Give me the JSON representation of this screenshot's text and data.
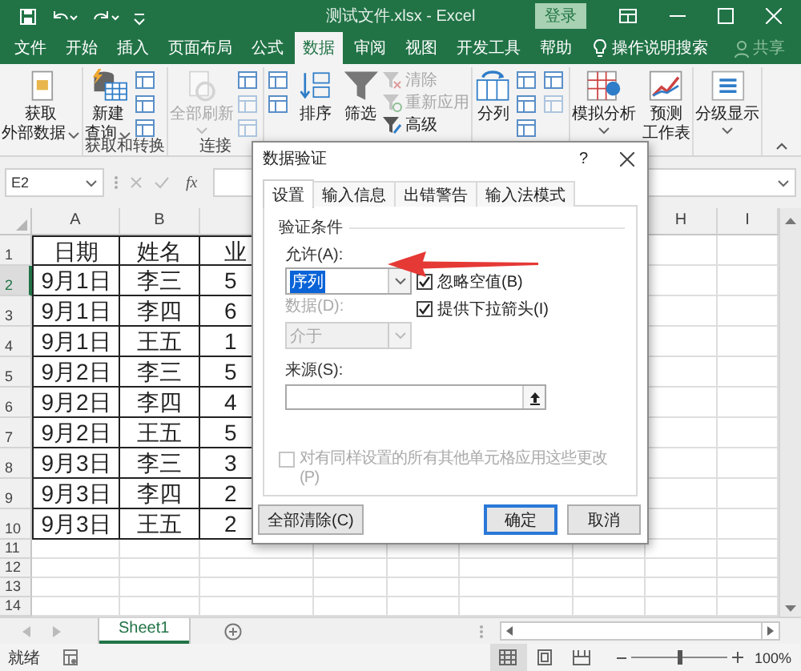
{
  "title_bar": {
    "title": "测试文件.xlsx  -  Excel",
    "sign_in": "登录"
  },
  "ribbon_tabs": [
    {
      "label": "文件",
      "selected": false
    },
    {
      "label": "开始",
      "selected": false
    },
    {
      "label": "插入",
      "selected": false
    },
    {
      "label": "页面布局",
      "selected": false
    },
    {
      "label": "公式",
      "selected": false
    },
    {
      "label": "数据",
      "selected": true
    },
    {
      "label": "审阅",
      "selected": false
    },
    {
      "label": "视图",
      "selected": false
    },
    {
      "label": "开发工具",
      "selected": false
    },
    {
      "label": "帮助",
      "selected": false
    }
  ],
  "tell_me": "操作说明搜索",
  "share": "共享",
  "ribbon_groups": [
    {
      "items": [
        {
          "kind": "large",
          "lines": [
            "获取",
            "外部数据"
          ],
          "dropdown": true,
          "disabled": false
        }
      ]
    },
    {
      "label": "获取和转换",
      "items": [
        {
          "kind": "large",
          "lines": [
            "新建",
            "查询"
          ],
          "dropdown": true,
          "disabled": false
        },
        {
          "kind": "icons",
          "icons": [
            {
              "disabled": false
            },
            {
              "disabled": false
            },
            {
              "disabled": false
            }
          ]
        }
      ]
    },
    {
      "label": "连接",
      "items": [
        {
          "kind": "large",
          "lines": [
            "全部刷新"
          ],
          "dropdown": true,
          "disabled": true
        },
        {
          "kind": "icons",
          "icons": [
            {
              "disabled": false
            },
            {
              "disabled": true
            },
            {
              "disabled": true
            }
          ]
        }
      ]
    },
    {
      "items": [
        {
          "kind": "icons",
          "icons": [
            {
              "disabled": false
            },
            {
              "disabled": false
            }
          ]
        },
        {
          "kind": "large",
          "lines": [
            "排序"
          ],
          "dropdown": false,
          "disabled": false
        },
        {
          "kind": "large",
          "lines": [
            "筛选"
          ],
          "dropdown": false,
          "disabled": false
        },
        {
          "kind": "list",
          "entries": [
            {
              "label": "清除",
              "disabled": true
            },
            {
              "label": "重新应用",
              "disabled": true
            },
            {
              "label": "高级",
              "disabled": false
            }
          ]
        }
      ]
    },
    {
      "items": [
        {
          "kind": "large",
          "lines": [
            "分列"
          ],
          "dropdown": false,
          "disabled": false
        },
        {
          "kind": "icons",
          "icons": [
            {
              "disabled": false
            },
            {
              "disabled": false
            },
            {
              "disabled": false
            }
          ]
        },
        {
          "kind": "icons",
          "icons": [
            {
              "disabled": false
            },
            {
              "disabled": true
            }
          ]
        }
      ]
    },
    {
      "items": [
        {
          "kind": "large",
          "lines": [
            "模拟分析"
          ],
          "dropdown": true,
          "disabled": false
        },
        {
          "kind": "large",
          "lines": [
            "预测",
            "工作表"
          ],
          "dropdown": false,
          "disabled": false
        }
      ]
    },
    {
      "items": [
        {
          "kind": "large",
          "lines": [
            "分级显示"
          ],
          "dropdown": true,
          "disabled": false
        }
      ]
    }
  ],
  "formula_bar": {
    "name_box": "E2",
    "function_button": "fx"
  },
  "sheet": {
    "column_headers_left": [
      "A",
      "B"
    ],
    "column_headers_right": [
      "H",
      "I"
    ],
    "rows": [
      {
        "number": "1",
        "selected": false,
        "cells": [
          "日期",
          "姓名",
          "业"
        ]
      },
      {
        "number": "2",
        "selected": true,
        "cells": [
          "9月1日",
          "李三",
          "5"
        ]
      },
      {
        "number": "3",
        "selected": false,
        "cells": [
          "9月1日",
          "李四",
          "6"
        ]
      },
      {
        "number": "4",
        "selected": false,
        "cells": [
          "9月1日",
          "王五",
          "1"
        ]
      },
      {
        "number": "5",
        "selected": false,
        "cells": [
          "9月2日",
          "李三",
          "5"
        ]
      },
      {
        "number": "6",
        "selected": false,
        "cells": [
          "9月2日",
          "李四",
          "4"
        ]
      },
      {
        "number": "7",
        "selected": false,
        "cells": [
          "9月2日",
          "王五",
          "5"
        ]
      },
      {
        "number": "8",
        "selected": false,
        "cells": [
          "9月3日",
          "李三",
          "3"
        ]
      },
      {
        "number": "9",
        "selected": false,
        "cells": [
          "9月3日",
          "李四",
          "2"
        ]
      },
      {
        "number": "10",
        "selected": false,
        "cells": [
          "9月3日",
          "王五",
          "2"
        ]
      },
      {
        "number": "11",
        "selected": false,
        "cells": []
      },
      {
        "number": "12",
        "selected": false,
        "cells": []
      },
      {
        "number": "13",
        "selected": false,
        "cells": []
      },
      {
        "number": "14",
        "selected": false,
        "cells": []
      }
    ]
  },
  "sheet_tabs": [
    {
      "label": "Sheet1",
      "selected": true
    }
  ],
  "status_bar": {
    "status": "就绪",
    "views": [
      {
        "selected": true
      },
      {
        "selected": false
      },
      {
        "selected": false
      }
    ],
    "zoom": {
      "level": 0.5,
      "reading": "100%"
    }
  },
  "dialog": {
    "title": "数据验证",
    "help": "?",
    "tabs": [
      {
        "label": "设置",
        "selected": true
      },
      {
        "label": "输入信息",
        "selected": false
      },
      {
        "label": "出错警告",
        "selected": false
      },
      {
        "label": "输入法模式",
        "selected": false
      }
    ],
    "section": "验证条件",
    "allow": {
      "label": "允许(A):",
      "value": "序列",
      "focused": true
    },
    "checkboxes": [
      {
        "label": "忽略空值(B)",
        "checked": true
      },
      {
        "label": "提供下拉箭头(I)",
        "checked": true
      }
    ],
    "data": {
      "label": "数据(D):",
      "value": "介于",
      "disabled": true
    },
    "source": {
      "label": "来源(S):"
    },
    "apply_all": {
      "label": "对有同样设置的所有其他单元格应用这些更改(P)",
      "checked": false,
      "disabled": true
    },
    "buttons": [
      {
        "label": "全部清除(C)",
        "default": false
      },
      {
        "label": "确定",
        "default": true
      },
      {
        "label": "取消",
        "default": false
      }
    ]
  }
}
